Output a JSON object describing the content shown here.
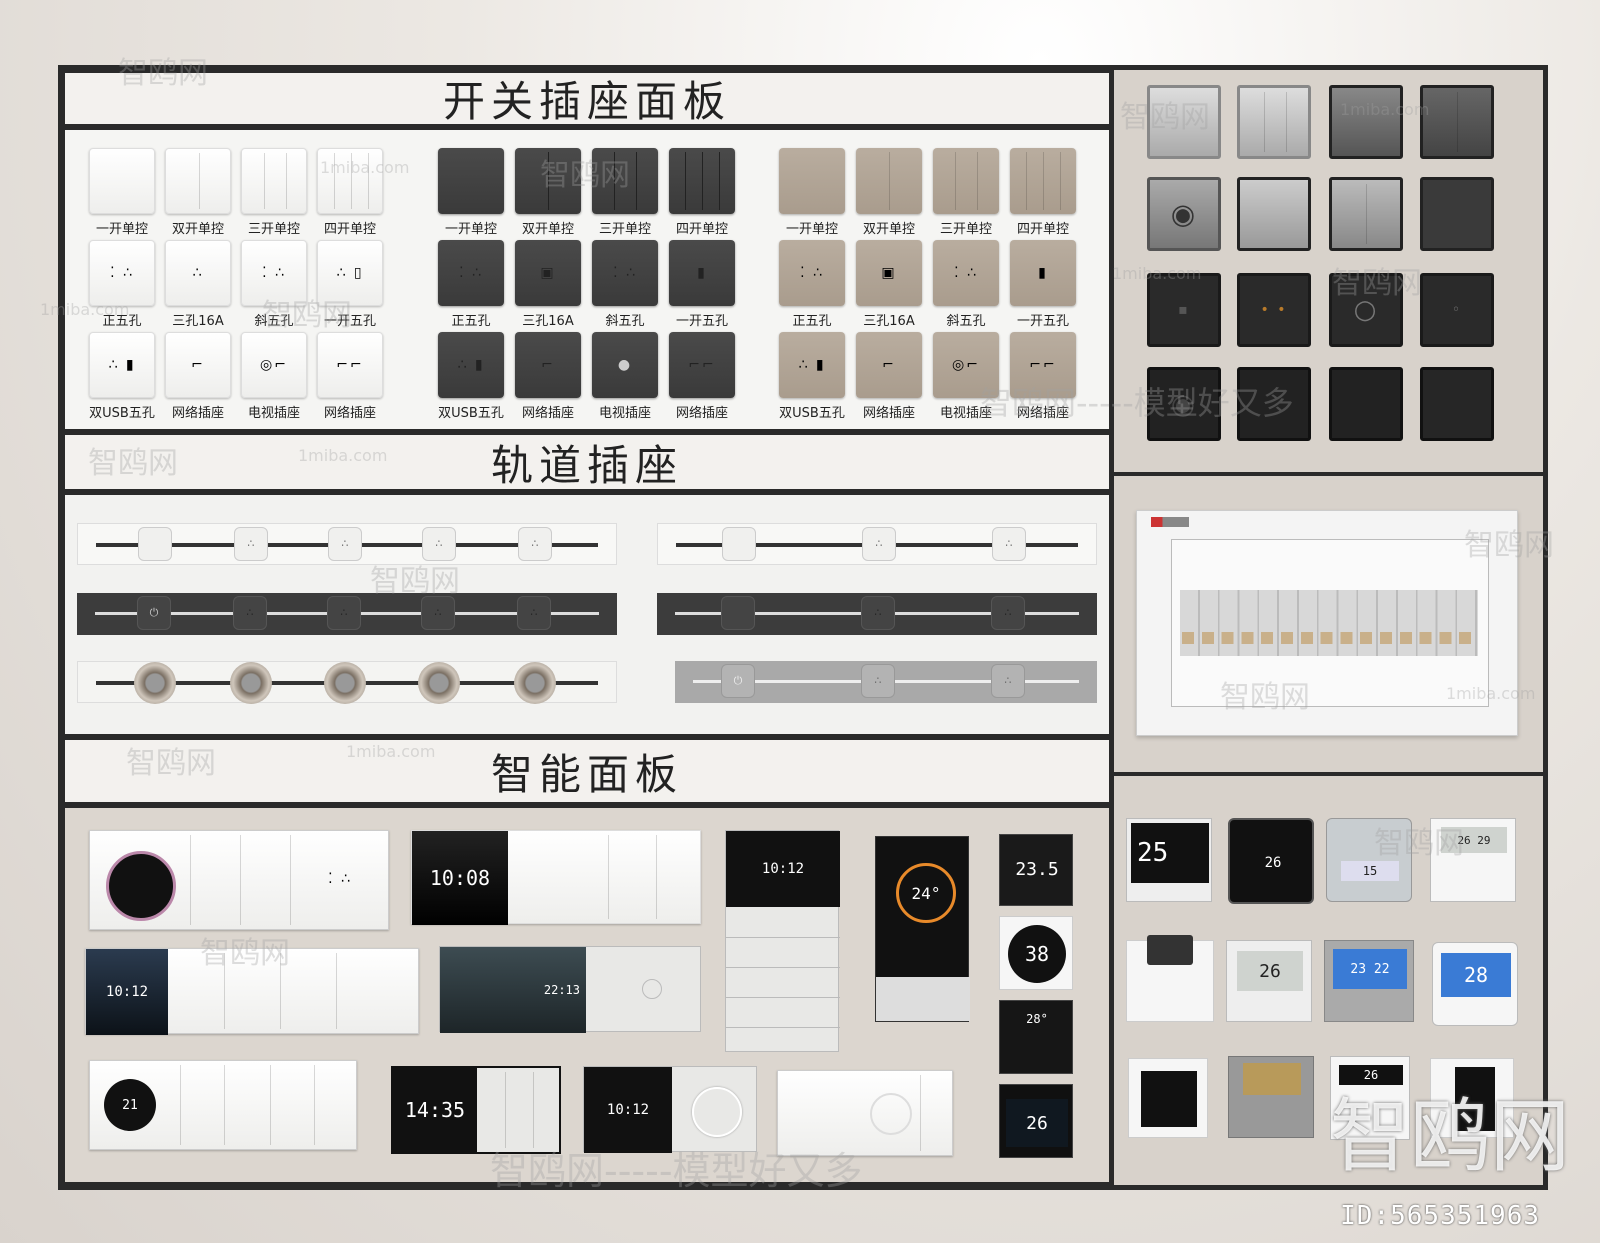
{
  "titles": {
    "switch_socket": "开关插座面板",
    "track_socket": "轨道插座",
    "smart_panel": "智能面板"
  },
  "panel_labels": {
    "row1": [
      "一开单控",
      "双开单控",
      "三开单控",
      "四开单控"
    ],
    "row2": [
      "正五孔",
      "三孔16A",
      "斜五孔",
      "一开五孔"
    ],
    "row3": [
      "双USB五孔",
      "网络插座",
      "电视插座",
      "网络插座"
    ]
  },
  "smart_screens": {
    "s1": "10:08",
    "s2": "10:12",
    "s3": "24°",
    "s4": "23.5",
    "s5": "38",
    "s6": "28°",
    "s7": "26",
    "s8": "10:12",
    "s9": "22:13",
    "s10": "21",
    "s11": "14:35",
    "s12": "10:12"
  },
  "thermostats": {
    "t1": "25",
    "t2": "26",
    "t3": "15",
    "t4": "26 29",
    "t5": "26",
    "t6": "23 22",
    "t7": "28",
    "t8": "26"
  },
  "watermarks": {
    "brand_cn": "智鸥网",
    "brand_en": "1miba.com",
    "slogan": "智鸥网-----模型好又多"
  },
  "id_text": "ID:565351963"
}
